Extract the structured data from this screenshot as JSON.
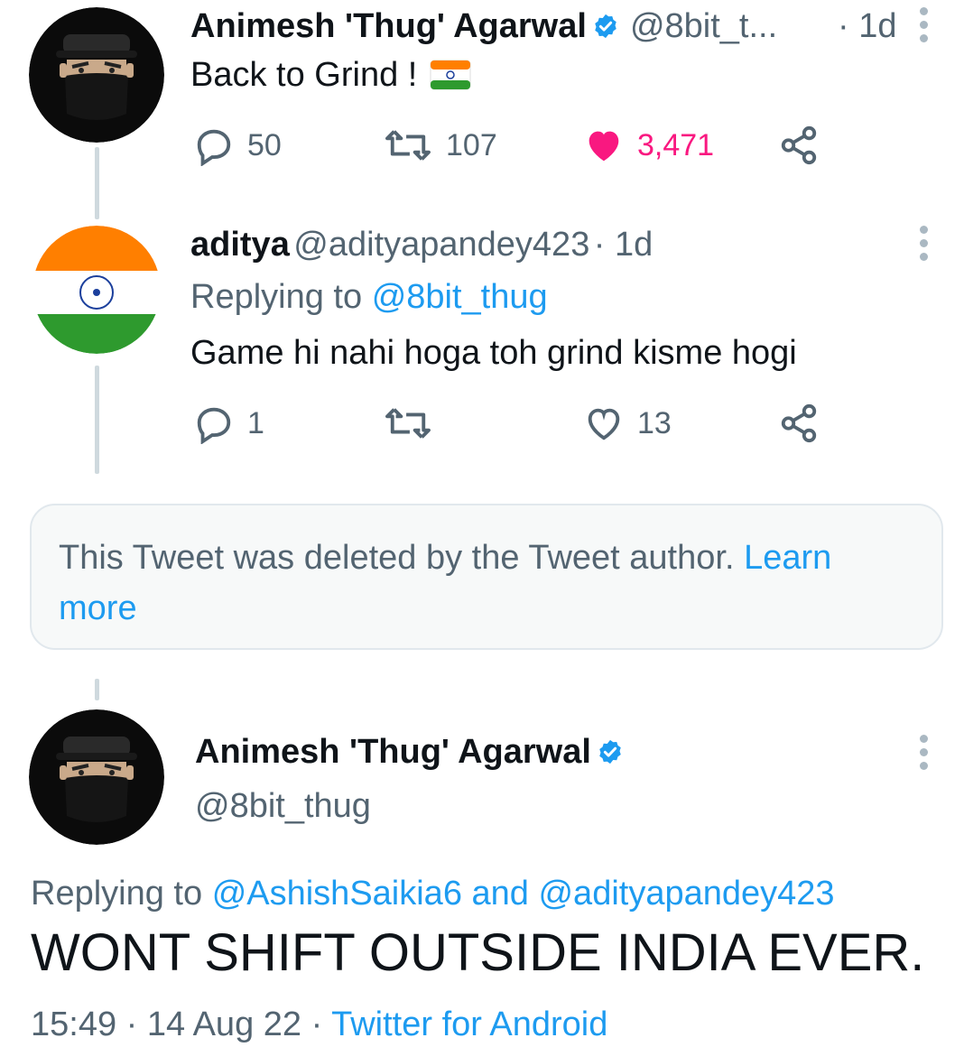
{
  "tweet1": {
    "display_name": "Animesh 'Thug' Agarwal",
    "handle": "@8bit_t...",
    "time": "· 1d",
    "text": "Back to Grind !",
    "flag_icon": "india-flag-icon",
    "replies": "50",
    "retweets": "107",
    "likes": "3,471",
    "liked": true,
    "like_color": "#f91880"
  },
  "reply": {
    "display_name": "aditya",
    "handle": "@adityapandey423",
    "time": "· 1d",
    "replying_prefix": "Replying to",
    "replying_to": "@8bit_thug",
    "text": "Game hi nahi hoga toh grind kisme hogi",
    "replies": "1",
    "retweets": "",
    "likes": "13"
  },
  "deleted": {
    "text": "This Tweet was deleted by the Tweet author.",
    "learn_more_line1": "Learn",
    "learn_more_line2": "more"
  },
  "main_tweet": {
    "display_name": "Animesh 'Thug' Agarwal",
    "handle": "@8bit_thug",
    "replying_prefix": "Replying to",
    "replying_to_1": "@AshishSaikia6",
    "replying_and": "and",
    "replying_to_2": "@adityapandey423",
    "text": "WONT SHIFT OUTSIDE INDIA EVER.",
    "time": "15:49 · 14 Aug 22 ·",
    "source": "Twitter for Android"
  },
  "colors": {
    "link": "#1d9bf0",
    "verified": "#1d9bf0",
    "muted": "#536471",
    "saffron": "#ff7f00",
    "green": "#2e9a2e"
  }
}
